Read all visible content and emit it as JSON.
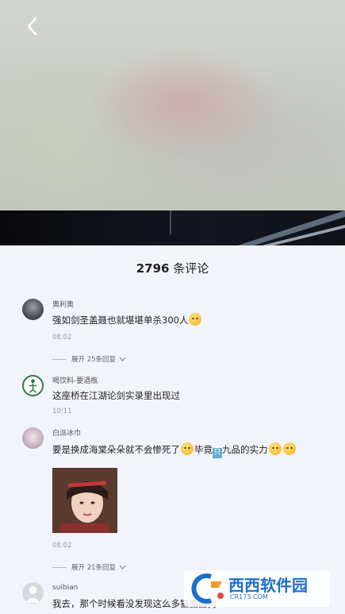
{
  "comments_header": {
    "count": "2796",
    "label": "条评论"
  },
  "comments": [
    {
      "username": "奥利奥",
      "text_before": "强如剑圣盖聂也就堪堪单杀300人",
      "time": "08:02",
      "expand_label": "展开 25条回复"
    },
    {
      "username": "喝饮料-要酒瓶",
      "text_before": "这座桥在江湖论剑实录里出现过",
      "time": "10:11"
    },
    {
      "username": "白派冰巾",
      "text_part1": "要是换成海棠朵朵就不会惨死了",
      "text_part2": "毕竟",
      "text_boxchar": "只",
      "text_part3": "九品的实力",
      "time": "08:02",
      "expand_label": "展开 21条回复"
    },
    {
      "username": "suibian",
      "text_before": "我去，那个时候看没发现这么多猫面猫狗"
    }
  ],
  "watermark": {
    "brand": "西西软件园",
    "url": "CR173.COM"
  }
}
